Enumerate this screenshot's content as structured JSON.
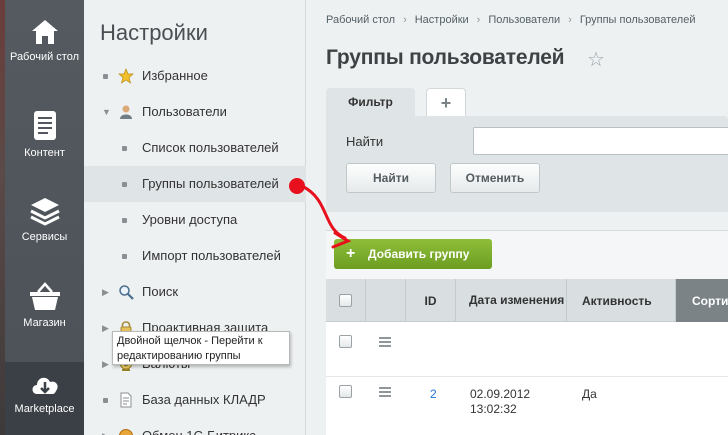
{
  "rail": {
    "items": [
      {
        "label": "Рабочий стол",
        "icon": "home-icon"
      },
      {
        "label": "Контент",
        "icon": "document-icon"
      },
      {
        "label": "Сервисы",
        "icon": "layers-icon"
      },
      {
        "label": "Магазин",
        "icon": "basket-icon"
      },
      {
        "label": "Marketplace",
        "icon": "cloud-download-icon"
      }
    ]
  },
  "panel": {
    "title": "Настройки",
    "items": [
      {
        "label": "Избранное",
        "icon": "star-icon"
      },
      {
        "label": "Пользователи",
        "icon": "user-icon"
      },
      {
        "label": "Список пользователей"
      },
      {
        "label": "Группы пользователей"
      },
      {
        "label": "Уровни доступа"
      },
      {
        "label": "Импорт пользователей"
      },
      {
        "label": "Поиск",
        "icon": "search-icon"
      },
      {
        "label": "Проактивная защита",
        "icon": "lock-icon"
      },
      {
        "label": "Валюты",
        "icon": "coin-icon"
      },
      {
        "label": "База данных КЛАДР",
        "icon": "page-icon"
      },
      {
        "label": "Обмен 1С-Битрикс",
        "icon": "exchange-icon"
      }
    ]
  },
  "breadcrumb": [
    "Рабочий стол",
    "Настройки",
    "Пользователи",
    "Группы пользователей"
  ],
  "page_title": "Группы пользователей",
  "tabs": {
    "filter": "Фильтр",
    "add": "+"
  },
  "filter": {
    "find_label": "Найти",
    "find_value": "",
    "find_button": "Найти",
    "cancel_button": "Отменить"
  },
  "grid": {
    "add_button": "Добавить группу",
    "add_plus": "+",
    "columns": {
      "id": "ID",
      "date": "Дата изменения",
      "active": "Активность",
      "sort": "Сорти"
    },
    "rows": [
      {
        "id": "",
        "date": "",
        "active": ""
      },
      {
        "id": "2",
        "date": "02.09.2012 13:02:32",
        "active": "Да"
      }
    ]
  },
  "tooltip": "Двойной щелчок - Перейти к редактированию группы",
  "colors": {
    "accent_green": "#7aab28",
    "annotation_red": "#e8101c",
    "rail": "#51575c"
  }
}
